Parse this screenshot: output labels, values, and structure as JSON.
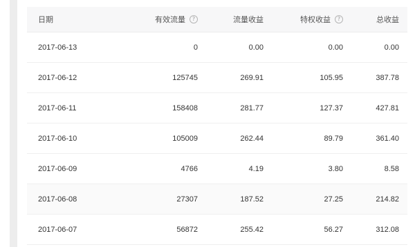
{
  "table": {
    "headers": {
      "date": "日期",
      "effective_traffic": "有效流量",
      "traffic_revenue": "流量收益",
      "privilege_revenue": "特权收益",
      "total_revenue": "总收益"
    },
    "help_icon_glyph": "?",
    "rows": [
      {
        "date": "2017-06-13",
        "effective_traffic": "0",
        "traffic_revenue": "0.00",
        "privilege_revenue": "0.00",
        "total_revenue": "0.00"
      },
      {
        "date": "2017-06-12",
        "effective_traffic": "125745",
        "traffic_revenue": "269.91",
        "privilege_revenue": "105.95",
        "total_revenue": "387.78"
      },
      {
        "date": "2017-06-11",
        "effective_traffic": "158408",
        "traffic_revenue": "281.77",
        "privilege_revenue": "127.37",
        "total_revenue": "427.81"
      },
      {
        "date": "2017-06-10",
        "effective_traffic": "105009",
        "traffic_revenue": "262.44",
        "privilege_revenue": "89.79",
        "total_revenue": "361.40"
      },
      {
        "date": "2017-06-09",
        "effective_traffic": "4766",
        "traffic_revenue": "4.19",
        "privilege_revenue": "3.80",
        "total_revenue": "8.58"
      },
      {
        "date": "2017-06-08",
        "effective_traffic": "27307",
        "traffic_revenue": "187.52",
        "privilege_revenue": "27.25",
        "total_revenue": "214.82"
      },
      {
        "date": "2017-06-07",
        "effective_traffic": "56872",
        "traffic_revenue": "255.42",
        "privilege_revenue": "56.27",
        "total_revenue": "312.08"
      }
    ]
  },
  "colors": {
    "header_bg": "#f7f7f8",
    "row_border": "#efefef",
    "text": "#333333",
    "side_rail": "#ededed"
  }
}
